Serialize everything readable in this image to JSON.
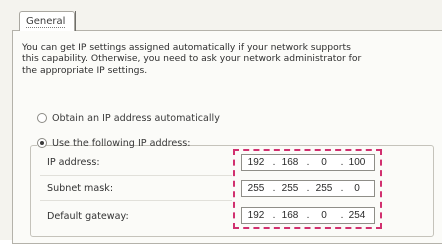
{
  "tabs": [
    {
      "label": "General",
      "selected": true
    }
  ],
  "description": [
    "You can get IP settings assigned automatically if your network supports",
    "this capability. Otherwise, you need to ask your network administrator for",
    "the appropriate IP settings."
  ],
  "options": {
    "obtain_auto": {
      "label": "Obtain an IP address automatically",
      "selected": false
    },
    "use_following": {
      "label": "Use the following IP address:",
      "selected": true
    }
  },
  "fields": {
    "ip_address": {
      "label": "IP address:",
      "octets": [
        "192",
        "168",
        "0",
        "100"
      ],
      "separator": "."
    },
    "subnet_mask": {
      "label": "Subnet mask:",
      "octets": [
        "255",
        "255",
        "255",
        "0"
      ],
      "separator": "."
    },
    "default_gateway": {
      "label": "Default gateway:",
      "octets": [
        "192",
        "168",
        "0",
        "254"
      ],
      "separator": "."
    }
  },
  "colors": {
    "highlight": "#d1306f",
    "panel_background": "#fbfbf8",
    "window_background": "#f4f3ee"
  }
}
